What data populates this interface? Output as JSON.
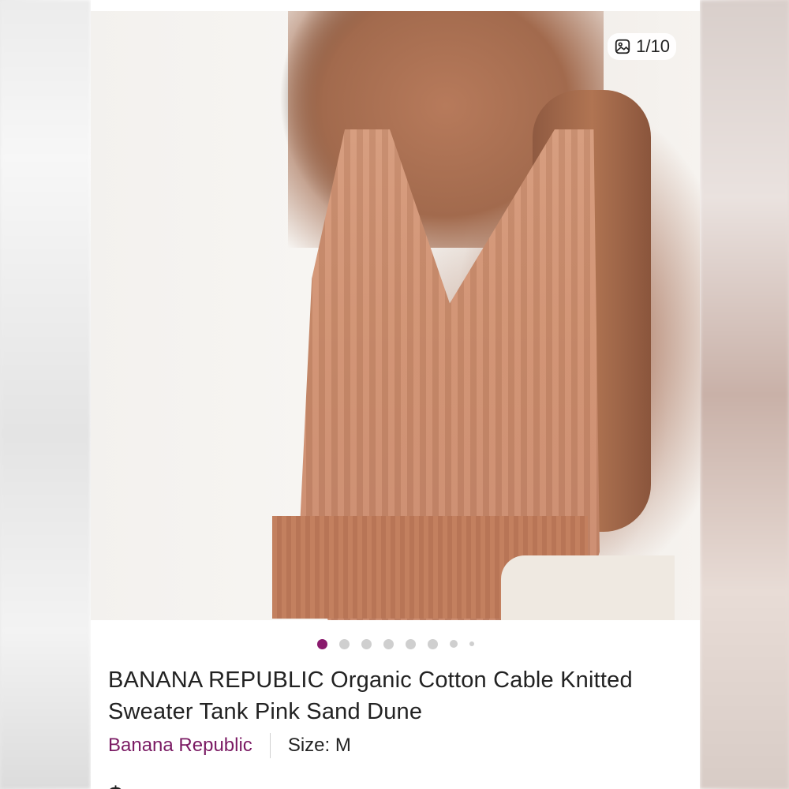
{
  "photo": {
    "counter": "1/10",
    "counter_icon": "gallery-icon",
    "total_dots": 8,
    "active_index": 0
  },
  "listing": {
    "title": "BANANA REPUBLIC Organic Cotton Cable Knitted Sweater Tank Pink Sand Dune",
    "brand": "Banana Republic",
    "size": "Size: M",
    "price_partial": "$"
  },
  "colors": {
    "brand": "#7a1a63",
    "dot_active": "#8a1a6d",
    "dot_inactive": "#cfcfcf"
  }
}
